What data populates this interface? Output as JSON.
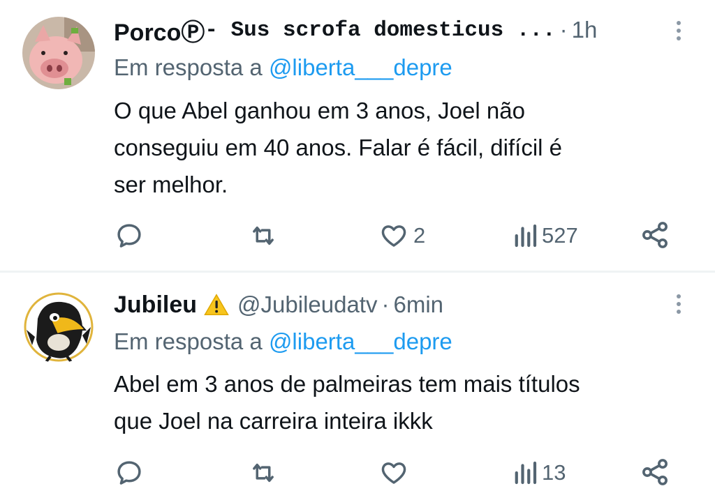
{
  "tweets": [
    {
      "display_name": "PorcoⓅ",
      "name_suffix": " - Sus scrofa domesticus ...",
      "separator": "·",
      "time": "1h",
      "reply_prefix": "Em resposta a ",
      "reply_to": "@liberta___depre",
      "text_lines": [
        "O que Abel ganhou em 3 anos, Joel não",
        "conseguiu em 40 anos. Falar é fácil, difícil é",
        "ser melhor."
      ],
      "likes": "2",
      "views": "527"
    },
    {
      "display_name": "Jubileu",
      "warning_emoji": "⚠️",
      "handle": "@Jubileudatv",
      "separator": "·",
      "time": "6min",
      "reply_prefix": "Em resposta a ",
      "reply_to": "@liberta___depre",
      "text_lines": [
        "Abel em 3 anos de palmeiras tem mais títulos",
        "que Joel na carreira inteira ikkk"
      ],
      "views": "13"
    }
  ],
  "colors": {
    "text": "#0f1419",
    "secondary": "#536471",
    "link": "#1d9bf0",
    "divider": "#eff3f4"
  },
  "icons": [
    "reply-icon",
    "retweet-icon",
    "heart-icon",
    "views-icon",
    "share-icon",
    "more-icon",
    "warning-icon"
  ]
}
